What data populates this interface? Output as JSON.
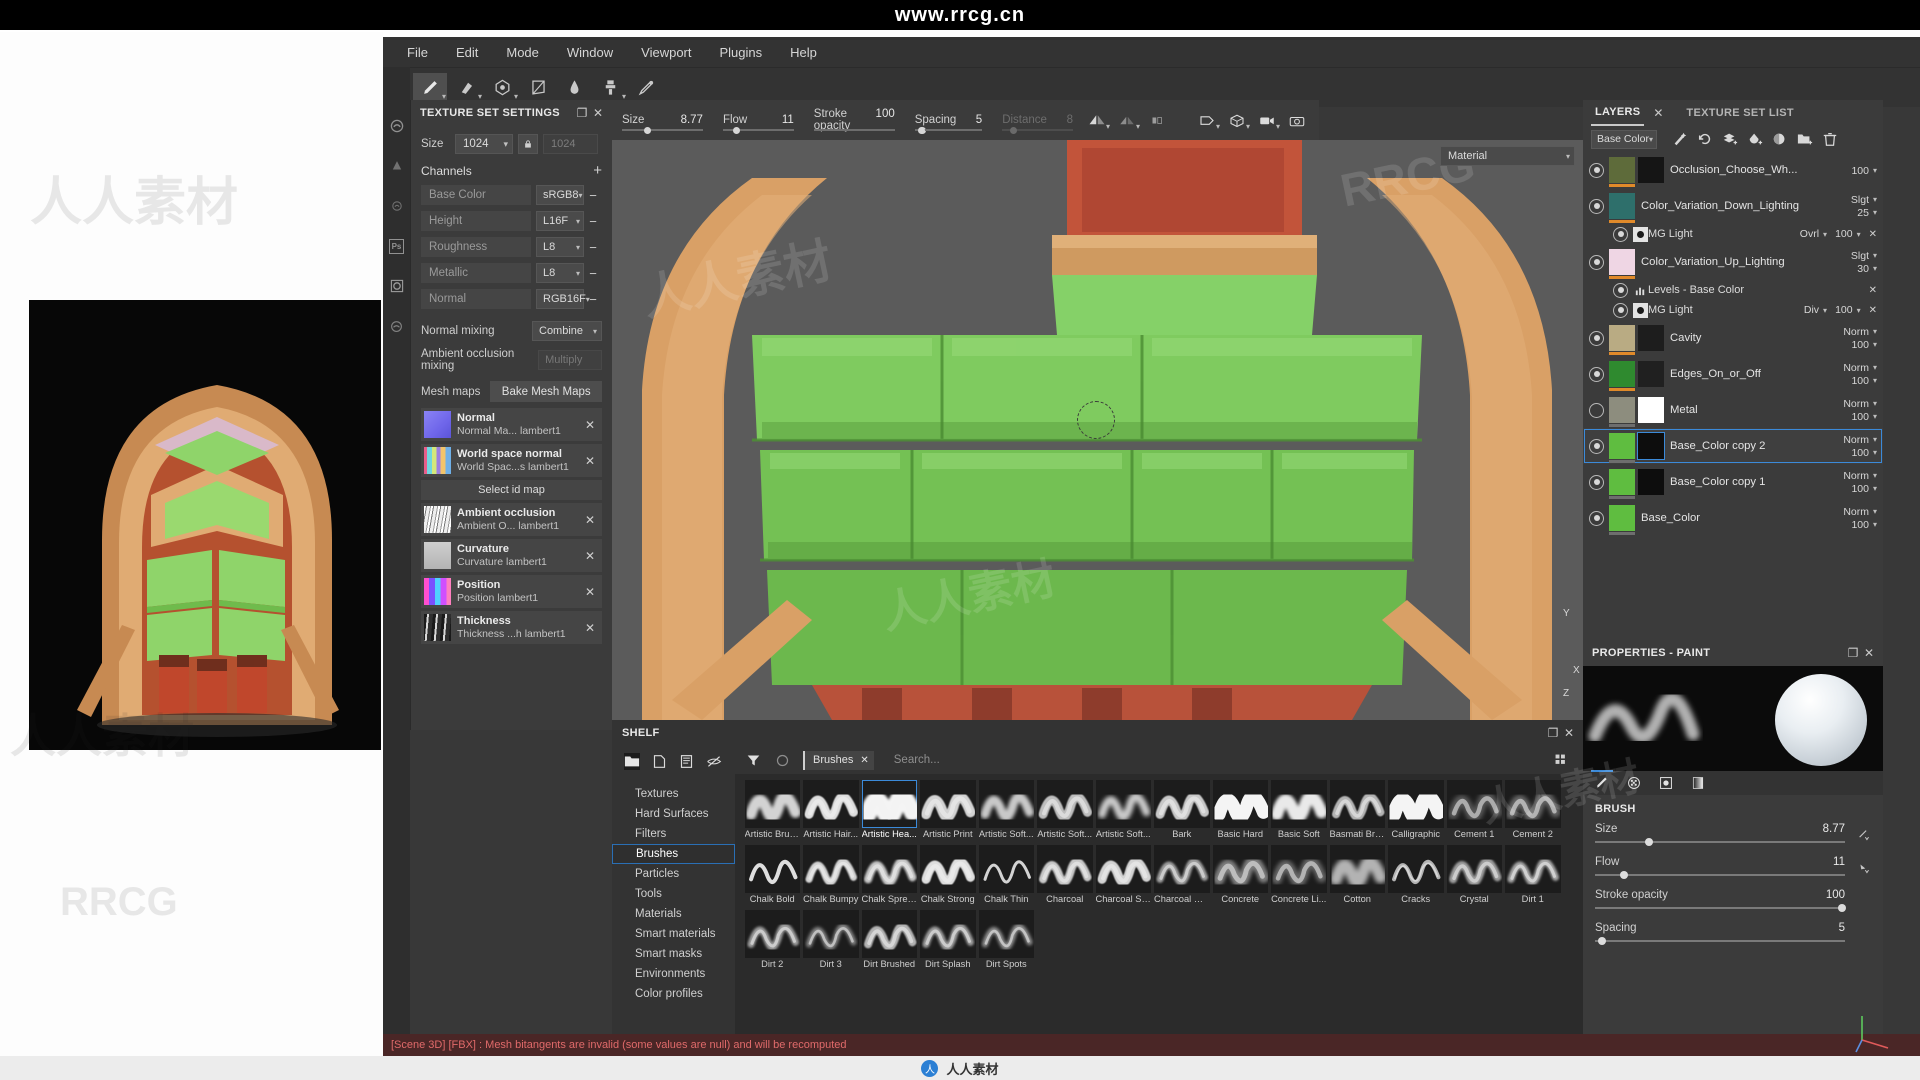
{
  "watermark": {
    "top_url": "www.rrcg.cn",
    "tile": "人人素材",
    "tile2": "RRCG",
    "bottom_brand": "人人素材"
  },
  "menubar": {
    "items": [
      "File",
      "Edit",
      "Mode",
      "Window",
      "Viewport",
      "Plugins",
      "Help"
    ]
  },
  "toolbar": {
    "tools": [
      {
        "name": "paint-brush-tool",
        "icon": "brush",
        "active": true,
        "caret": true
      },
      {
        "name": "eraser-tool",
        "icon": "eraser",
        "active": false,
        "caret": true
      },
      {
        "name": "projection-tool",
        "icon": "projection",
        "active": false,
        "caret": true
      },
      {
        "name": "polygon-fill-tool",
        "icon": "polyfill",
        "active": false,
        "caret": false
      },
      {
        "name": "smudge-tool",
        "icon": "smudge",
        "active": false,
        "caret": false
      },
      {
        "name": "clone-tool",
        "icon": "clone",
        "active": false,
        "caret": true
      },
      {
        "name": "material-picker-tool",
        "icon": "picker",
        "active": false,
        "caret": false
      }
    ]
  },
  "texture_set_settings": {
    "title": "TEXTURE SET SETTINGS",
    "size_label": "Size",
    "size_value": "1024",
    "size_locked_value": "1024",
    "channels_label": "Channels",
    "add_channel": "+",
    "channels": [
      {
        "name": "Base Color",
        "format": "sRGB8"
      },
      {
        "name": "Height",
        "format": "L16F"
      },
      {
        "name": "Roughness",
        "format": "L8"
      },
      {
        "name": "Metallic",
        "format": "L8"
      },
      {
        "name": "Normal",
        "format": "RGB16F"
      }
    ],
    "normal_mixing_label": "Normal mixing",
    "normal_mixing_value": "Combine",
    "ao_mixing_label": "Ambient occlusion mixing",
    "ao_mixing_value": "Multiply",
    "mesh_maps_label": "Mesh maps",
    "bake_button": "Bake Mesh Maps",
    "select_id_map": "Select id map",
    "mesh_maps": [
      {
        "title": "Normal",
        "sub": "Normal Ma... lambert1",
        "thumb": "#7b74f0"
      },
      {
        "title": "World space normal",
        "sub": "World Spac...s lambert1",
        "thumb": "#9ad2d8"
      },
      {
        "title": "Ambient occlusion",
        "sub": "Ambient O... lambert1",
        "thumb": "#dedede"
      },
      {
        "title": "Curvature",
        "sub": "Curvature lambert1",
        "thumb": "#b9b9b9"
      },
      {
        "title": "Position",
        "sub": "Position lambert1",
        "thumb": "#c061c8"
      },
      {
        "title": "Thickness",
        "sub": "Thickness ...h lambert1",
        "thumb": "#505050"
      }
    ]
  },
  "brush_bar": {
    "params": [
      {
        "name": "Size",
        "value": "8.77",
        "pct": 20,
        "disabled": false
      },
      {
        "name": "Flow",
        "value": "11",
        "pct": 11,
        "disabled": false
      },
      {
        "name": "Stroke opacity",
        "value": "100",
        "pct": 100,
        "disabled": false
      },
      {
        "name": "Spacing",
        "value": "5",
        "pct": 5,
        "disabled": false
      },
      {
        "name": "Distance",
        "value": "8",
        "pct": 8,
        "disabled": true
      }
    ],
    "viewport_buttons": [
      "symmetry-icon",
      "symmetry-plane-icon",
      "mirror-icon",
      "camera-persp-icon",
      "cube-3d-icon",
      "video-icon",
      "screenshot-icon"
    ]
  },
  "viewport": {
    "material_selector": "Material",
    "axis_labels": {
      "x": "X",
      "y": "Y",
      "z": "Z"
    }
  },
  "shelf": {
    "title": "SHELF",
    "toolbar_icons": [
      "folder-icon",
      "new-file-icon",
      "save-icon",
      "hide-icon",
      "import-icon"
    ],
    "filter_icon": "filter-icon",
    "refresh_icon": "refresh-icon",
    "chip_label": "Brushes",
    "search_placeholder": "Search...",
    "grid_view_icon": "grid-view-icon",
    "categories": [
      "Textures",
      "Hard Surfaces",
      "Filters",
      "Brushes",
      "Particles",
      "Tools",
      "Materials",
      "Smart materials",
      "Smart masks",
      "Environments",
      "Color profiles"
    ],
    "selected_category": "Brushes",
    "items": [
      {
        "label": "Artistic Brus...",
        "style": "soft-wave",
        "selected": false
      },
      {
        "label": "Artistic Hair...",
        "style": "hair-wave",
        "selected": false
      },
      {
        "label": "Artistic Hea...",
        "style": "heavy-wave",
        "selected": true
      },
      {
        "label": "Artistic Print",
        "style": "print-wave",
        "selected": false
      },
      {
        "label": "Artistic Soft...",
        "style": "soft2-wave",
        "selected": false
      },
      {
        "label": "Artistic Soft...",
        "style": "grain-wave",
        "selected": false
      },
      {
        "label": "Artistic Soft...",
        "style": "soft3-wave",
        "selected": false
      },
      {
        "label": "Bark",
        "style": "bark-wave",
        "selected": false
      },
      {
        "label": "Basic Hard",
        "style": "hard-wave",
        "selected": false
      },
      {
        "label": "Basic Soft",
        "style": "basic-soft",
        "selected": false
      },
      {
        "label": "Basmati Bru...",
        "style": "grain2-wave",
        "selected": false
      },
      {
        "label": "Calligraphic",
        "style": "calli-wave",
        "selected": false
      },
      {
        "label": "Cement 1",
        "style": "cement1",
        "selected": false
      },
      {
        "label": "Cement 2",
        "style": "cement2",
        "selected": false
      },
      {
        "label": "Chalk Bold",
        "style": "chalk-bold",
        "selected": false
      },
      {
        "label": "Chalk Bumpy",
        "style": "chalk-bumpy",
        "selected": false
      },
      {
        "label": "Chalk Spread",
        "style": "chalk-spread",
        "selected": false
      },
      {
        "label": "Chalk Strong",
        "style": "chalk-strong",
        "selected": false
      },
      {
        "label": "Chalk Thin",
        "style": "chalk-thin",
        "selected": false
      },
      {
        "label": "Charcoal",
        "style": "charcoal",
        "selected": false
      },
      {
        "label": "Charcoal Str...",
        "style": "charcoal-str",
        "selected": false
      },
      {
        "label": "Charcoal Wi...",
        "style": "charcoal-wi",
        "selected": false
      },
      {
        "label": "Concrete",
        "style": "concrete",
        "selected": false
      },
      {
        "label": "Concrete Li...",
        "style": "concrete-li",
        "selected": false
      },
      {
        "label": "Cotton",
        "style": "cotton",
        "selected": false
      },
      {
        "label": "Cracks",
        "style": "cracks",
        "selected": false
      },
      {
        "label": "Crystal",
        "style": "crystal",
        "selected": false
      },
      {
        "label": "Dirt 1",
        "style": "dirt1",
        "selected": false
      },
      {
        "label": "Dirt 2",
        "style": "dirt2",
        "selected": false
      },
      {
        "label": "Dirt 3",
        "style": "dirt3",
        "selected": false
      },
      {
        "label": "Dirt Brushed",
        "style": "dirt-brushed",
        "selected": false
      },
      {
        "label": "Dirt Splash",
        "style": "dirt-splash",
        "selected": false
      },
      {
        "label": "Dirt Spots",
        "style": "dirt-spots",
        "selected": false
      }
    ]
  },
  "layers_panel": {
    "tab_layers": "LAYERS",
    "tab_texture_set_list": "TEXTURE SET LIST",
    "channel_selector": "Base Color",
    "toolbar_icons": [
      "add-effect-icon",
      "add-filter-icon",
      "add-fill-layer-icon",
      "add-paint-layer-icon",
      "add-smart-material-icon",
      "add-folder-icon",
      "delete-layer-icon"
    ],
    "layers": [
      {
        "name": "Occlusion_Choose_Wh...",
        "mode": "",
        "opacity": "100",
        "visible": true,
        "selected": false,
        "type": "group",
        "thumb1": "#5e6b3a",
        "thumb2": "#151515",
        "accent": "#e08a2a"
      },
      {
        "name": "Color_Variation_Down_Lighting",
        "mode": "Slgt",
        "opacity": "25",
        "visible": true,
        "selected": false,
        "type": "group",
        "thumb1": "#2e6f6b",
        "thumb2": "",
        "accent": "#e08a2a"
      },
      {
        "name": "MG Light",
        "mode": "Ovrl",
        "opacity": "100",
        "visible": true,
        "selected": false,
        "type": "effect",
        "thumb1": "",
        "thumb2": "",
        "accent": ""
      },
      {
        "name": "Color_Variation_Up_Lighting",
        "mode": "Slgt",
        "opacity": "30",
        "visible": true,
        "selected": false,
        "type": "group",
        "thumb1": "#efd6e4",
        "thumb2": "",
        "accent": "#e08a2a"
      },
      {
        "name": "Levels - Base Color",
        "mode": "",
        "opacity": "",
        "visible": true,
        "selected": false,
        "type": "effect-levels",
        "thumb1": "",
        "thumb2": "",
        "accent": ""
      },
      {
        "name": "MG Light",
        "mode": "Div",
        "opacity": "100",
        "visible": true,
        "selected": false,
        "type": "effect",
        "thumb1": "",
        "thumb2": "",
        "accent": ""
      },
      {
        "name": "Cavity",
        "mode": "Norm",
        "opacity": "100",
        "visible": true,
        "selected": false,
        "type": "layer",
        "thumb1": "#b9ab83",
        "thumb2": "#1d1d1d",
        "accent": "#e08a2a"
      },
      {
        "name": "Edges_On_or_Off",
        "mode": "Norm",
        "opacity": "100",
        "visible": true,
        "selected": false,
        "type": "layer",
        "thumb1": "#2f8a2f",
        "thumb2": "#202020",
        "accent": "#e08a2a"
      },
      {
        "name": "Metal",
        "mode": "Norm",
        "opacity": "100",
        "visible": false,
        "selected": false,
        "type": "layer",
        "thumb1": "#8d8d7e",
        "thumb2": "#ffffff",
        "accent": "#6e6e6e"
      },
      {
        "name": "Base_Color copy 2",
        "mode": "Norm",
        "opacity": "100",
        "visible": true,
        "selected": true,
        "type": "layer",
        "thumb1": "#5fbd40",
        "thumb2": "#0d0d0d",
        "accent": "#6e6e6e"
      },
      {
        "name": "Base_Color copy 1",
        "mode": "Norm",
        "opacity": "100",
        "visible": true,
        "selected": false,
        "type": "layer",
        "thumb1": "#5fbd40",
        "thumb2": "#0d0d0d",
        "accent": "#6e6e6e"
      },
      {
        "name": "Base_Color",
        "mode": "Norm",
        "opacity": "100",
        "visible": true,
        "selected": false,
        "type": "layer",
        "thumb1": "#5fbd40",
        "thumb2": "",
        "accent": "#6e6e6e"
      }
    ]
  },
  "properties": {
    "title": "PROPERTIES - PAINT",
    "tabs": [
      "brush-tab-icon",
      "alpha-tab-icon",
      "material-tab-icon",
      "gradient-tab-icon"
    ],
    "brush_title": "BRUSH",
    "sliders": [
      {
        "name": "Size",
        "value": "8.77",
        "pct": 20,
        "icon": "pen-pressure-icon"
      },
      {
        "name": "Flow",
        "value": "11",
        "pct": 10,
        "icon": "pen-tilt-icon"
      },
      {
        "name": "Stroke opacity",
        "value": "100",
        "pct": 100,
        "icon": ""
      },
      {
        "name": "Spacing",
        "value": "5",
        "pct": 2,
        "icon": ""
      }
    ]
  },
  "status": {
    "message": "[Scene 3D] [FBX] : Mesh bitangents are invalid (some values are null) and will be recomputed"
  }
}
